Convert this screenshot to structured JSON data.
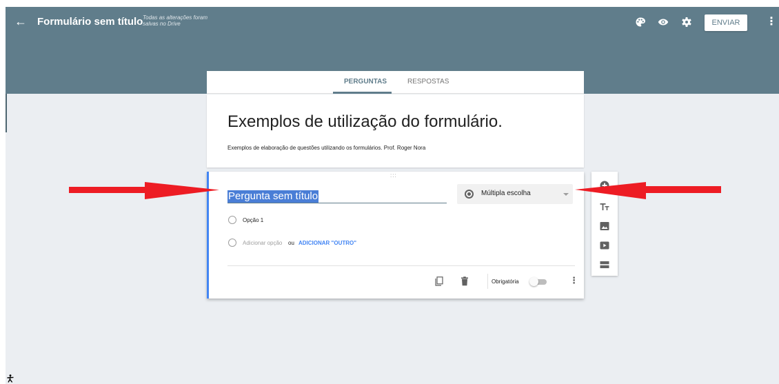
{
  "header": {
    "back_icon": "arrow-left-icon",
    "title": "Formulário sem título",
    "saved_status": "Todas as alterações foram salvas no Drive",
    "icons": [
      "palette-icon",
      "eye-icon",
      "gear-icon"
    ],
    "send_label": "ENVIAR",
    "more_icon": "more-vert-icon"
  },
  "tabs": [
    {
      "label": "PERGUNTAS",
      "active": true
    },
    {
      "label": "RESPOSTAS",
      "active": false
    }
  ],
  "form": {
    "title": "Exemplos de utilização do formulário.",
    "description": "Exemplos de elaboração de questões utilizando os formulários.  Prof. Roger Nora"
  },
  "question": {
    "drag_handle": ":::",
    "title": "Pergunta sem título",
    "type": "Múltipla escolha",
    "options": [
      "Opção 1"
    ],
    "add_option": "Adicionar opção",
    "add_or": "ou",
    "add_other": "ADICIONAR \"OUTRO\"",
    "required_label": "Obrigatória",
    "required": false,
    "footer_icons": [
      "copy-icon",
      "trash-icon",
      "more-vert-icon"
    ]
  },
  "side_toolbar": [
    "add-circle-icon",
    "title-text-icon",
    "image-icon",
    "video-icon",
    "section-icon"
  ],
  "annotations": {
    "arrow_color": "#ed1c24"
  },
  "colors": {
    "header": "#607d8b",
    "background": "#ebeef2",
    "accent": "#4285f4"
  }
}
